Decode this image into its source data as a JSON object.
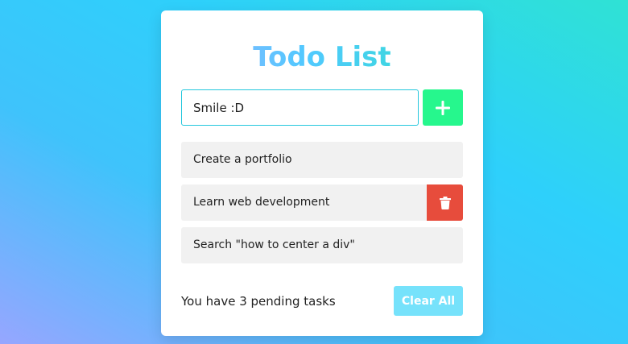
{
  "colors": {
    "add_button": "#26f78d",
    "delete_button": "#e74c3c",
    "clear_button": "#76e2fb",
    "input_border": "#25c7dd",
    "task_bg": "#f1f1f1"
  },
  "app": {
    "title": "Todo List"
  },
  "input": {
    "value": "Smile :D",
    "add_icon": "plus-icon"
  },
  "tasks": [
    {
      "label": "Create a portfolio"
    },
    {
      "label": "Learn web development",
      "delete_icon": "trash-icon"
    },
    {
      "label": "Search \"how to center a div\""
    }
  ],
  "footer": {
    "pending_text": "You have 3 pending tasks",
    "clear_label": "Clear All"
  }
}
